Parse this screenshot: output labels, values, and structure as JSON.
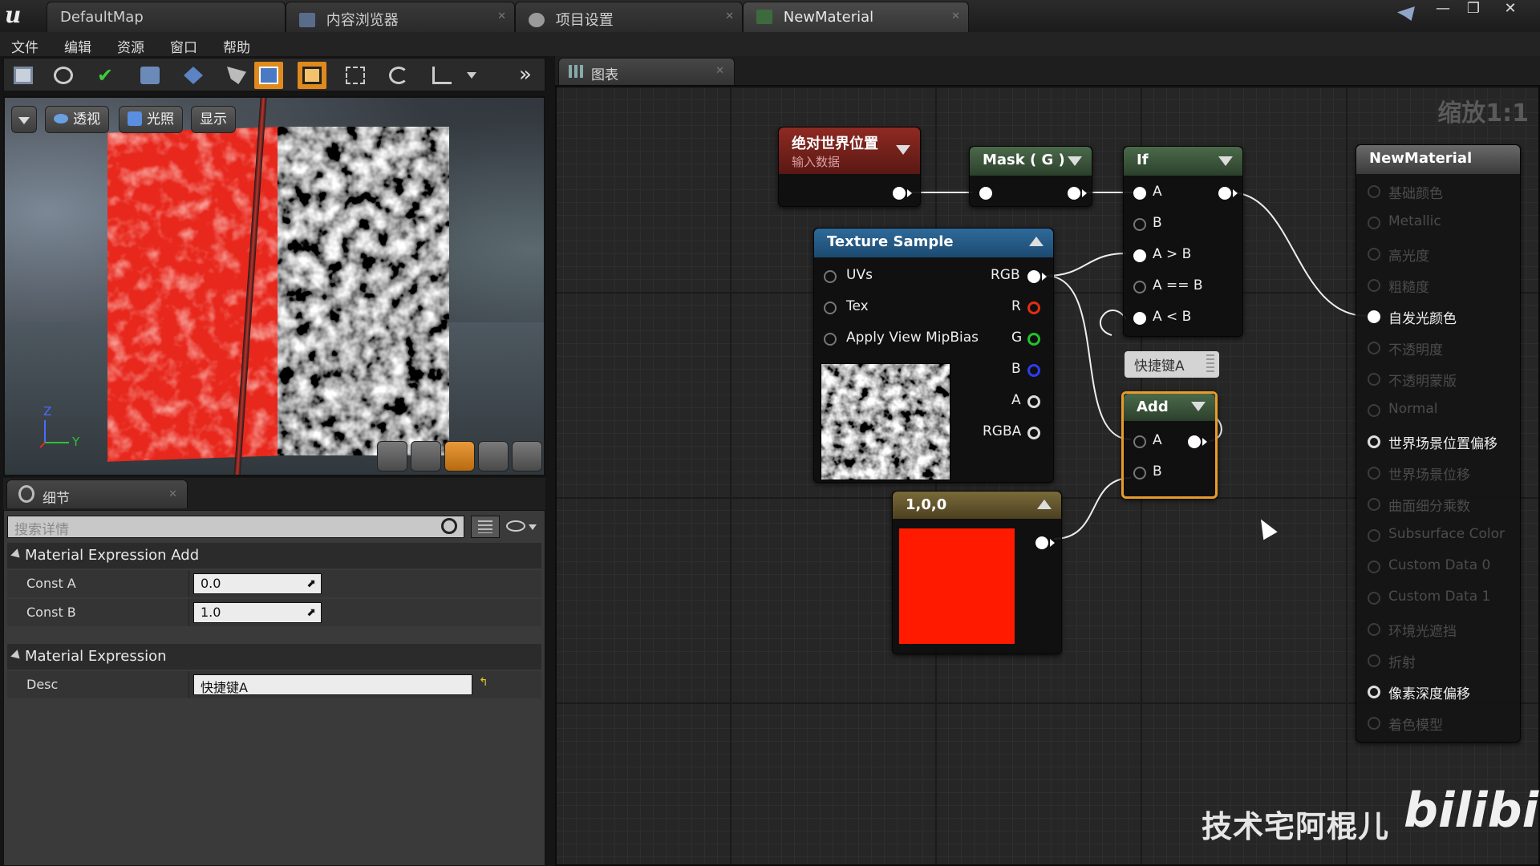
{
  "tabs": [
    {
      "label": "DefaultMap",
      "active": false
    },
    {
      "label": "内容浏览器",
      "active": false
    },
    {
      "label": "项目设置",
      "active": false
    },
    {
      "label": "NewMaterial",
      "active": true
    }
  ],
  "menu": [
    "文件",
    "编辑",
    "资源",
    "窗口",
    "帮助"
  ],
  "viewport": {
    "buttons": {
      "perspective": "透视",
      "lighting": "光照",
      "show": "显示"
    },
    "axis": {
      "z": "Z",
      "y": "Y"
    }
  },
  "details": {
    "tab_title": "细节",
    "search_placeholder": "搜索详情",
    "sections": [
      {
        "title": "Material Expression Add",
        "props": [
          {
            "name": "Const A",
            "value": "0.0"
          },
          {
            "name": "Const B",
            "value": "1.0"
          }
        ]
      },
      {
        "title": "Material Expression",
        "props": [
          {
            "name": "Desc",
            "value": "快捷键A"
          }
        ]
      }
    ]
  },
  "graph": {
    "tab_title": "图表",
    "zoom": "缩放1:1",
    "nodes": {
      "world_pos": {
        "title": "绝对世界位置",
        "subtitle": "输入数据"
      },
      "mask": {
        "title": "Mask ( G )"
      },
      "if_node": {
        "title": "If",
        "pins": [
          "A",
          "B",
          "A > B",
          "A == B",
          "A < B"
        ]
      },
      "texture": {
        "title": "Texture Sample",
        "inputs": [
          "UVs",
          "Tex",
          "Apply View MipBias"
        ],
        "outputs": [
          "RGB",
          "R",
          "G",
          "B",
          "A",
          "RGBA"
        ]
      },
      "comment": {
        "text": "快捷键A"
      },
      "add": {
        "title": "Add",
        "pins": [
          "A",
          "B"
        ]
      },
      "constant": {
        "title": "1,0,0",
        "color": "#ff1a00"
      },
      "material": {
        "title": "NewMaterial",
        "pins": [
          {
            "label": "基础颜色",
            "active": false
          },
          {
            "label": "Metallic",
            "active": false
          },
          {
            "label": "高光度",
            "active": false
          },
          {
            "label": "粗糙度",
            "active": false
          },
          {
            "label": "自发光颜色",
            "active": true,
            "connected": true
          },
          {
            "label": "不透明度",
            "active": false
          },
          {
            "label": "不透明蒙版",
            "active": false
          },
          {
            "label": "Normal",
            "active": false
          },
          {
            "label": "世界场景位置偏移",
            "active": true
          },
          {
            "label": "世界场景位移",
            "active": false
          },
          {
            "label": "曲面细分乘数",
            "active": false
          },
          {
            "label": "Subsurface Color",
            "active": false
          },
          {
            "label": "Custom Data 0",
            "active": false
          },
          {
            "label": "Custom Data 1",
            "active": false
          },
          {
            "label": "环境光遮挡",
            "active": false
          },
          {
            "label": "折射",
            "active": false
          },
          {
            "label": "像素深度偏移",
            "active": true
          },
          {
            "label": "着色模型",
            "active": false
          }
        ]
      }
    }
  },
  "watermark": {
    "author": "技术宅阿棍儿",
    "site": "bilibili"
  },
  "colors": {
    "accent": "#e08a1d",
    "red": "#e62c12",
    "green": "#22c22a",
    "blue": "#2d3df0"
  }
}
